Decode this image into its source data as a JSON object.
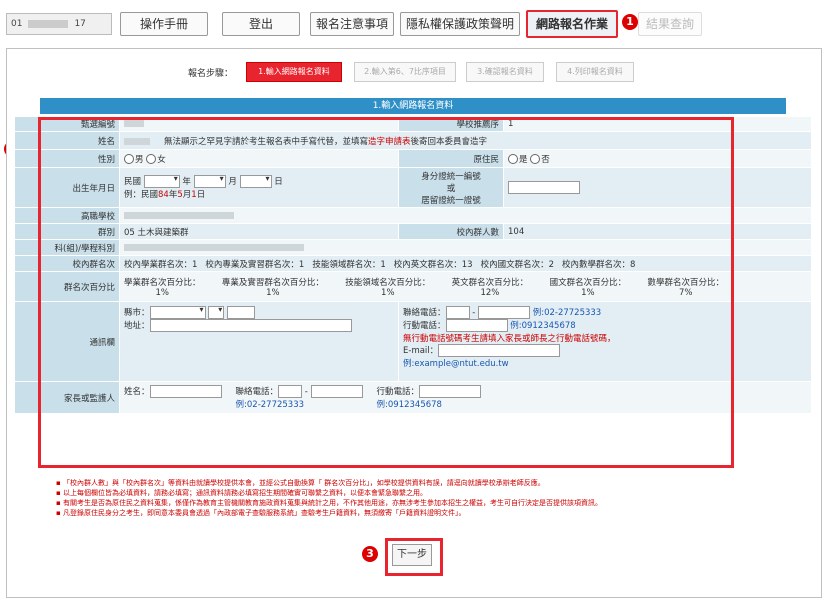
{
  "topbar": {
    "user_prefix": "01",
    "user_suffix": "17",
    "buttons": [
      {
        "label": "操作手冊"
      },
      {
        "label": "登出"
      },
      {
        "label": "報名注意事項"
      },
      {
        "label": "隱私權保護政策聲明"
      },
      {
        "label": "網路報名作業"
      },
      {
        "label": "結果查詢"
      }
    ],
    "badge1": "1"
  },
  "steps": {
    "label": "報名步驟：",
    "items": [
      "1.輸入網路報名資料",
      "2.輸入第6、7比序項目",
      "3.確認報名資料",
      "4.列印報名資料"
    ]
  },
  "section_title": "1.輸入網路報名資料",
  "badge2": "2",
  "badge3": "3",
  "form": {
    "exam_no_label": "甄選編號",
    "school_rec_label": "學校推薦序",
    "school_rec_value": "1",
    "name_label": "姓名",
    "name_note": "無法顯示之罕見字請於考生報名表中手寫代替，並填寫",
    "name_link": "造字申請表",
    "name_note2": "後寄回本委員會造字",
    "gender_label": "性別",
    "male": "男",
    "female": "女",
    "indigenous_label": "原住民",
    "yes": "是",
    "no": "否",
    "birth_label": "出生年月日",
    "birth_era": "民國",
    "year": "年",
    "month": "月",
    "day": "日",
    "birth_example_pre": "例：民國",
    "birth_example_y": "84",
    "birth_example_mid": "年",
    "birth_example_m": "5",
    "birth_example_mid2": "月",
    "birth_example_d": "1",
    "birth_example_end": "日",
    "id_label_1": "身分證統一編號",
    "id_label_2": "或",
    "id_label_3": "居留證統一證號",
    "school_label": "高職學校",
    "group_label": "群別",
    "group_value": "05 土木與建築群",
    "group_count_label": "校內群人數",
    "group_count_value": "104",
    "dept_label": "科(組)/學程科別",
    "rank_label": "校內群名次",
    "rank_items": [
      "校內學業群名次：1",
      "校內專業及實習群名次：1",
      "技能領域群名次：1",
      "校內英文群名次：13",
      "校內國文群名次：2",
      "校內數學群名次：8"
    ],
    "pct_label": "群名次百分比",
    "pct_items": [
      {
        "k": "學業群名次百分比：",
        "v": "1%"
      },
      {
        "k": "專業及實習群名次百分比：",
        "v": "1%"
      },
      {
        "k": "技能領域名次百分比：",
        "v": "1%"
      },
      {
        "k": "英文群名次百分比：",
        "v": "12%"
      },
      {
        "k": "國文群名次百分比：",
        "v": "1%"
      },
      {
        "k": "數學群名次百分比：",
        "v": "7%"
      }
    ],
    "contact_label": "通訊欄",
    "city_label": "縣市：",
    "addr_label": "地址：",
    "phone_label": "聯絡電話：",
    "phone_example": "例:02-27725333",
    "mobile_label": "行動電話：",
    "mobile_example": "例:0912345678",
    "mobile_note": "無行動電話號碼考生請填入家長或師長之行動電話號碼，",
    "email_label": "E-mail：",
    "email_example": "例:example@ntut.edu.tw",
    "guardian_label": "家長或監護人",
    "g_name_label": "姓名：",
    "g_phone_label": "聯絡電話：",
    "g_phone_example": "例:02-27725333",
    "g_mobile_label": "行動電話：",
    "g_mobile_example": "例:0912345678"
  },
  "notes": [
    "「校內群人數」與「校內群名次」等資料由就讀學校提供本會，並經公式自動換算「 群名次百分比」，如學校提供資料有誤，請逕向就讀學校承辦老師反應。",
    "以上每個欄位皆為必填資料，請務必填寫；通訊資料請務必填寫招生期間確實可聯繫之資料，以便本會緊急聯繫之用。",
    "有關考生是否為原住民之資料蒐集，係僅作為教育主管機關教育施政資料蒐集與統計之用，不作其他用途，亦無涉考生參加本招生之權益，考生可自行決定是否提供該項資訊。",
    "凡登錄原住民身分之考生，即同意本委員會透過「內政部電子查驗服務系統」查驗考生戶籍資料，無須繳寄「戶籍資料證明文件」。"
  ],
  "next_label": "下一步"
}
